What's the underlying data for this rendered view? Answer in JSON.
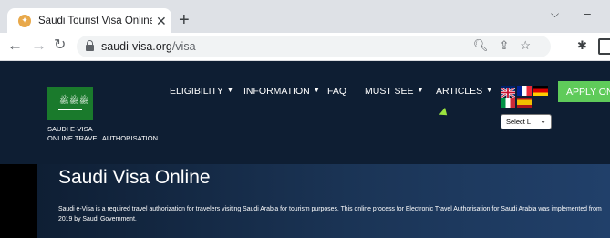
{
  "browser": {
    "tab_title": "Saudi Tourist Visa Online, Saudi V",
    "tab_close": "✕",
    "new_tab": "+",
    "url_host": "saudi-visa.org",
    "url_path": "/visa",
    "window_chevron": "⌵",
    "window_minimize": "–"
  },
  "site": {
    "logo_line1": "SAUDI E-VISA",
    "logo_line2": "ONLINE TRAVEL AUTHORISATION",
    "logo_script": "لا إله إلا الله",
    "nav": [
      {
        "label": "ELIGIBILITY",
        "dropdown": true
      },
      {
        "label": "INFORMATION",
        "dropdown": true
      },
      {
        "label": "FAQ",
        "dropdown": false
      },
      {
        "label": "MUST SEE",
        "dropdown": true
      },
      {
        "label": "ARTICLES",
        "dropdown": true
      }
    ],
    "caret": "▼",
    "languages": [
      "English",
      "French",
      "German",
      "Italian",
      "Spanish"
    ],
    "language_select_value": "Select L",
    "apply_button": "APPLY ONL"
  },
  "hero": {
    "title": "Saudi Visa Online",
    "body": "Saudi e-Visa is a required travel authorization for travelers visiting Saudi Arabia for tourism purposes. This online process for Electronic Travel Authorisation for Saudi Arabia was implemented from 2019 by Saudi Government."
  },
  "colors": {
    "header_bg": "#0e1e33",
    "apply_green": "#5fcb5a",
    "flag_green": "#1a7a2c"
  }
}
